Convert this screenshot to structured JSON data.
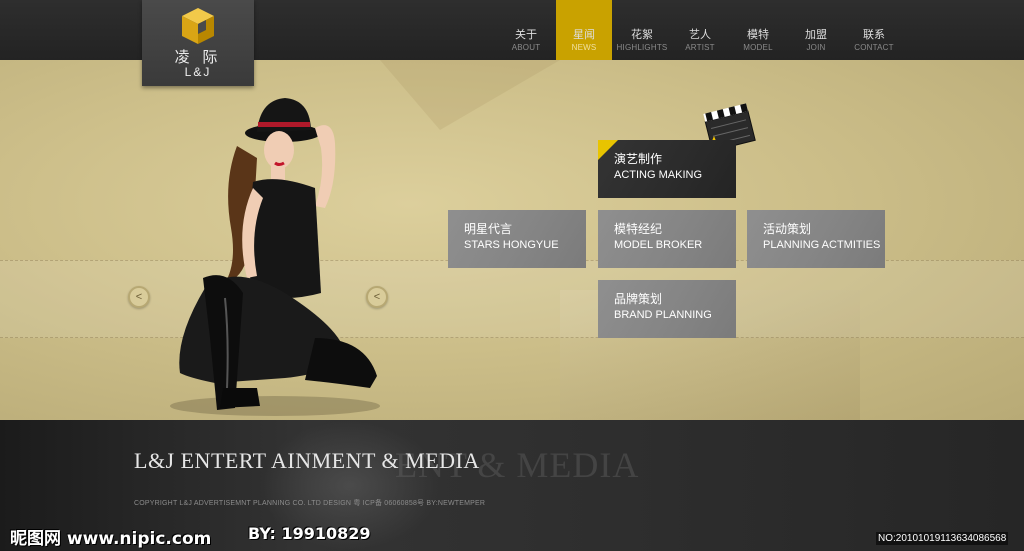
{
  "brand": {
    "logo_cn": "凌 际",
    "logo_en": "L&J",
    "accent": "#c9a200"
  },
  "nav": [
    {
      "cn": "关于",
      "en": "ABOUT",
      "active": false
    },
    {
      "cn": "星闻",
      "en": "NEWS",
      "active": true
    },
    {
      "cn": "花絮",
      "en": "HIGHLIGHTS",
      "active": false
    },
    {
      "cn": "艺人",
      "en": "ARTIST",
      "active": false
    },
    {
      "cn": "模特",
      "en": "MODEL",
      "active": false
    },
    {
      "cn": "加盟",
      "en": "JOIN",
      "active": false
    },
    {
      "cn": "联系",
      "en": "CONTACT",
      "active": false
    }
  ],
  "carousel": {
    "prev_label": "<",
    "next_label": "<"
  },
  "services": {
    "acting": {
      "cn": "演艺制作",
      "en": "ACTING MAKING"
    },
    "stars": {
      "cn": "明星代言",
      "en": "STARS HONGYUE"
    },
    "model": {
      "cn": "模特经纪",
      "en": "MODEL BROKER"
    },
    "planning": {
      "cn": "活动策划",
      "en": "PLANNING ACTMITIES"
    },
    "brand": {
      "cn": "品牌策划",
      "en": "BRAND PLANNING"
    }
  },
  "footer": {
    "title": "L&J ENTERT AINMENT & MEDIA",
    "title_shadow": "ENT & MEDIA",
    "copyright": "COPYRIGHT L&J ADVERTISEMNT PLANNING CO. LTD DESIGN 粤 ICP备 06060858号  BY:NEWTEMPER"
  },
  "watermark": {
    "site": "昵图网 www.nipic.com",
    "by": "BY: 19910829",
    "no": "NO:20101019113634086568"
  }
}
